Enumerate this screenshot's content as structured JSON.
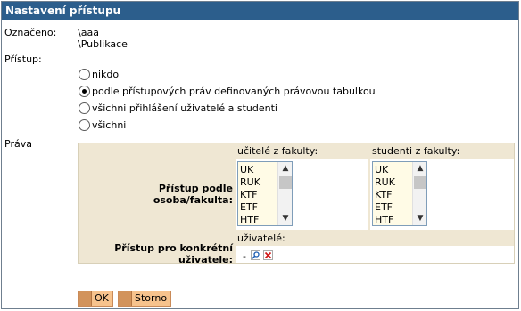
{
  "window": {
    "title": "Nastavení přístupu"
  },
  "marked": {
    "label": "Označeno:",
    "values": [
      "\\aaa",
      "\\Publikace"
    ]
  },
  "access": {
    "label": "Přístup:",
    "options": [
      {
        "label": "nikdo",
        "checked": false
      },
      {
        "label": "podle přístupových práv definovaných právovou tabulkou",
        "checked": true
      },
      {
        "label": "všichni přihlášení uživatelé a studenti",
        "checked": false
      },
      {
        "label": "všichni",
        "checked": false
      }
    ]
  },
  "rights": {
    "label": "Práva",
    "table": {
      "row1_label": "Přístup podle osoba/fakulta:",
      "col_teachers_header": "učitelé z fakulty:",
      "col_students_header": "studenti z fakulty:",
      "teachers_list": [
        "UK",
        "RUK",
        "KTF",
        "ETF",
        "HTF"
      ],
      "students_list": [
        "UK",
        "RUK",
        "KTF",
        "ETF",
        "HTF"
      ],
      "row2_label": "Přístup pro konkrétní uživatele:",
      "users_header": "uživatelé:",
      "users_value": "-"
    }
  },
  "buttons": {
    "ok": "OK",
    "cancel": "Storno"
  }
}
